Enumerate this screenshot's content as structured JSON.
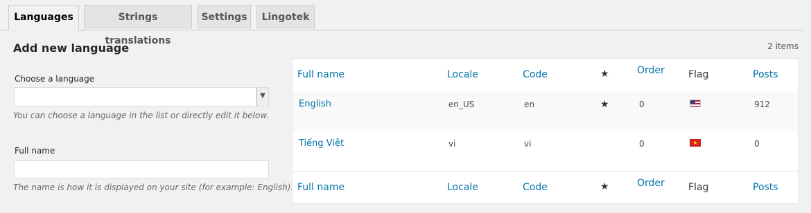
{
  "tabs": [
    {
      "label": "Languages",
      "active": true
    },
    {
      "label": "Strings translations"
    },
    {
      "label": "Settings"
    },
    {
      "label": "Lingotek"
    }
  ],
  "form": {
    "title": "Add new language",
    "choose_label": "Choose a language",
    "choose_value": "",
    "choose_help": "You can choose a language in the list or directly edit it below.",
    "fullname_label": "Full name",
    "fullname_value": "",
    "fullname_help": "The name is how it is displayed on your site (for example: English)."
  },
  "list": {
    "count": "2 items",
    "columns": {
      "full_name": "Full name",
      "locale": "Locale",
      "code": "Code",
      "default_icon": "star-icon",
      "order": "Order",
      "flag": "Flag",
      "posts": "Posts"
    },
    "rows": [
      {
        "full_name": "English",
        "locale": "en_US",
        "code": "en",
        "default": "★",
        "order": "0",
        "flag": "us-flag-icon",
        "posts": "912"
      },
      {
        "full_name": "Tiếng Việt",
        "locale": "vi",
        "code": "vi",
        "default": "",
        "order": "0",
        "flag": "vn-flag-icon",
        "posts": "0"
      }
    ]
  },
  "colors": {
    "link": "#0073aa",
    "background": "#f1f1f1"
  }
}
